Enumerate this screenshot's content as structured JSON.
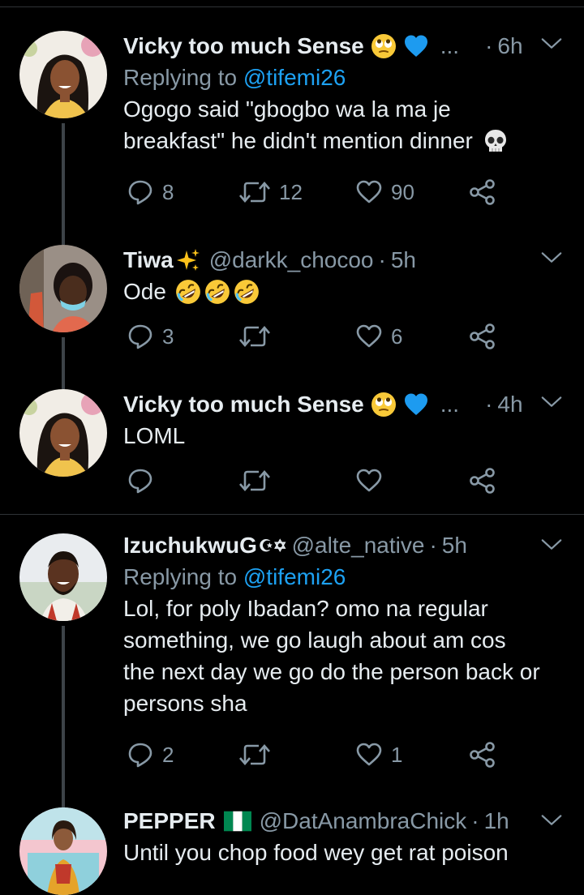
{
  "tweets": [
    {
      "name": "Vicky too much Sense",
      "handle": "",
      "ellipsis": "...",
      "time": "6h",
      "replying_prefix": "Replying to",
      "replying_to": "@tifemi26",
      "text_lines": [
        "Ogogo said \"gbogbo wa la ma je",
        "breakfast\" he didn't mention dinner"
      ],
      "replies": "8",
      "retweets": "12",
      "likes": "90"
    },
    {
      "name": "Tiwa",
      "handle": "@darkk_chocoo",
      "time": "5h",
      "text_lines": [
        "Ode"
      ],
      "replies": "3",
      "retweets": "",
      "likes": "6"
    },
    {
      "name": "Vicky too much Sense",
      "handle": "",
      "ellipsis": "...",
      "time": "4h",
      "text_lines": [
        "LOML"
      ],
      "replies": "",
      "retweets": "",
      "likes": ""
    },
    {
      "name": "IzuchukwuG",
      "handle": "@alte_native",
      "time": "5h",
      "replying_prefix": "Replying to",
      "replying_to": "@tifemi26",
      "text_lines": [
        "Lol, for poly Ibadan? omo na regular",
        "something, we go laugh about am cos",
        "the next day we go do the person back or",
        "persons sha"
      ],
      "replies": "2",
      "retweets": "",
      "likes": "1"
    },
    {
      "name": "PEPPER",
      "handle": "@DatAnambraChick",
      "time": "1h",
      "text_lines": [
        "Until you chop food wey get rat poison"
      ]
    }
  ],
  "icons": {
    "reply": "reply-icon",
    "retweet": "retweet-icon",
    "like": "heart-icon",
    "share": "share-icon",
    "caret": "chevron-down-icon"
  },
  "colors": {
    "background": "#000000",
    "text": "#e6ecf0",
    "secondary": "#8899a6",
    "link": "#1da1f2",
    "divider": "#2f3336"
  }
}
